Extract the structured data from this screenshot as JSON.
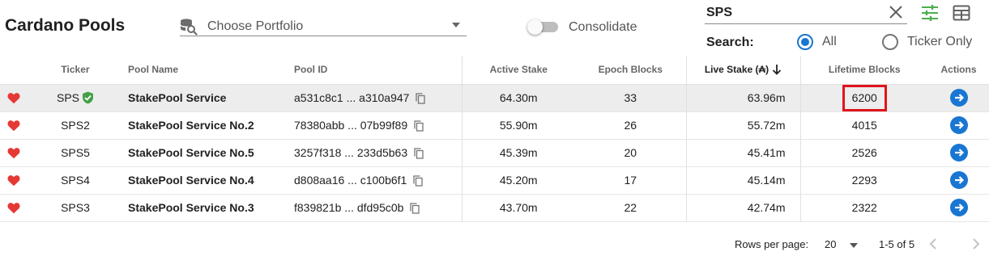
{
  "header": {
    "title": "Cardano Pools",
    "portfolio_placeholder": "Choose Portfolio",
    "consolidate_label": "Consolidate",
    "consolidate_on": false
  },
  "search": {
    "value": "SPS",
    "label": "Search:",
    "options": [
      {
        "label": "All",
        "selected": true
      },
      {
        "label": "Ticker Only",
        "selected": false
      }
    ]
  },
  "table": {
    "columns": {
      "ticker": "Ticker",
      "pool_name": "Pool Name",
      "pool_id": "Pool ID",
      "active_stake": "Active Stake",
      "epoch_blocks": "Epoch Blocks",
      "live_stake": "Live Stake (₳)",
      "lifetime_blocks": "Lifetime Blocks",
      "actions": "Actions"
    },
    "sorted_column": "live_stake",
    "sort_direction": "desc",
    "rows": [
      {
        "ticker": "SPS",
        "verified": true,
        "name": "StakePool Service",
        "pool_id": "a531c8c1 ... a310a947",
        "active_stake": "64.30m",
        "epoch_blocks": "33",
        "live_stake": "63.96m",
        "lifetime_blocks": "6200",
        "highlighted": true,
        "selected": true
      },
      {
        "ticker": "SPS2",
        "verified": false,
        "name": "StakePool Service No.2",
        "pool_id": "78380abb ... 07b99f89",
        "active_stake": "55.90m",
        "epoch_blocks": "26",
        "live_stake": "55.72m",
        "lifetime_blocks": "4015",
        "highlighted": false,
        "selected": false
      },
      {
        "ticker": "SPS5",
        "verified": false,
        "name": "StakePool Service No.5",
        "pool_id": "3257f318 ... 233d5b63",
        "active_stake": "45.39m",
        "epoch_blocks": "20",
        "live_stake": "45.41m",
        "lifetime_blocks": "2526",
        "highlighted": false,
        "selected": false
      },
      {
        "ticker": "SPS4",
        "verified": false,
        "name": "StakePool Service No.4",
        "pool_id": "d808aa16 ... c100b6f1",
        "active_stake": "45.20m",
        "epoch_blocks": "17",
        "live_stake": "45.14m",
        "lifetime_blocks": "2293",
        "highlighted": false,
        "selected": false
      },
      {
        "ticker": "SPS3",
        "verified": false,
        "name": "StakePool Service No.3",
        "pool_id": "f839821b ... dfd95c0b",
        "active_stake": "43.70m",
        "epoch_blocks": "22",
        "live_stake": "42.74m",
        "lifetime_blocks": "2322",
        "highlighted": false,
        "selected": false
      }
    ]
  },
  "pagination": {
    "rows_per_page_label": "Rows per page:",
    "rows_per_page": "20",
    "range": "1-5 of 5"
  },
  "icons": {
    "favorite": "heart-icon",
    "verified": "shield-check-icon",
    "copy": "copy-icon",
    "action": "arrow-right-circle-icon",
    "filter": "sliders-icon",
    "table_view": "table-icon",
    "clear": "close-icon"
  },
  "colors": {
    "heart": "#e53935",
    "verified": "#43a047",
    "primary": "#1976d2",
    "filter_icon": "#4caf50",
    "highlight_border": "#e0141c",
    "selected_row": "#ededed"
  }
}
